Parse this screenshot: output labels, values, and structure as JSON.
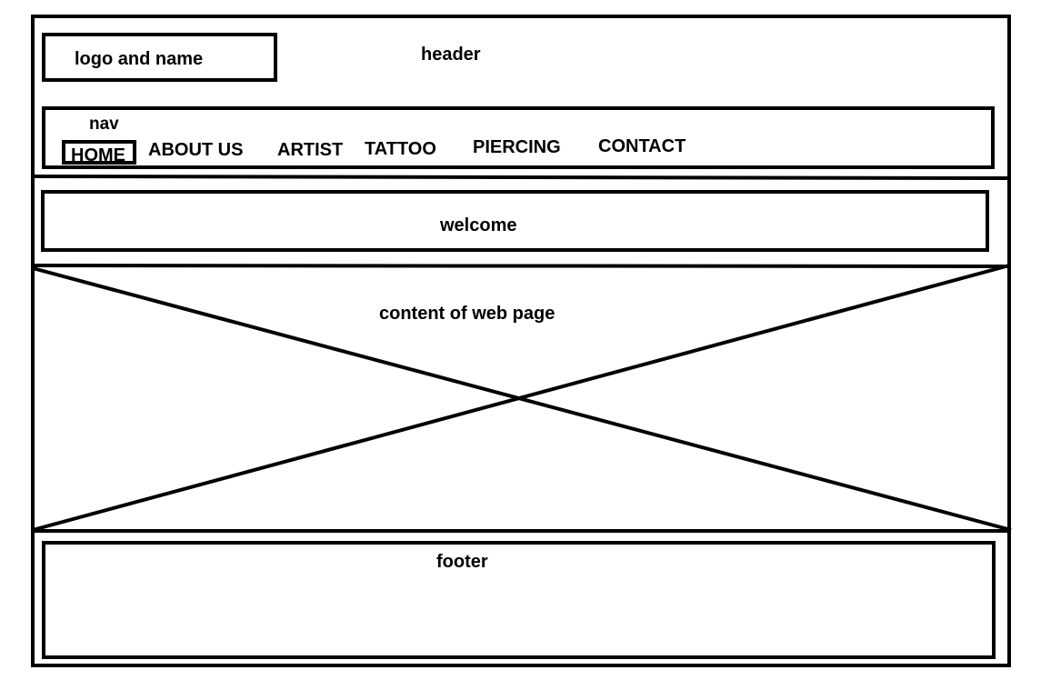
{
  "header": {
    "logo_label": "logo and name",
    "label": "header"
  },
  "nav": {
    "label": "nav",
    "items": [
      {
        "label": "HOME",
        "active": true
      },
      {
        "label": "ABOUT US",
        "active": false
      },
      {
        "label": "ARTIST",
        "active": false
      },
      {
        "label": "TATTOO",
        "active": false
      },
      {
        "label": "PIERCING",
        "active": false
      },
      {
        "label": "CONTACT",
        "active": false
      }
    ]
  },
  "welcome": {
    "label": "welcome"
  },
  "content": {
    "label": "content of web page"
  },
  "footer": {
    "label": "footer"
  }
}
